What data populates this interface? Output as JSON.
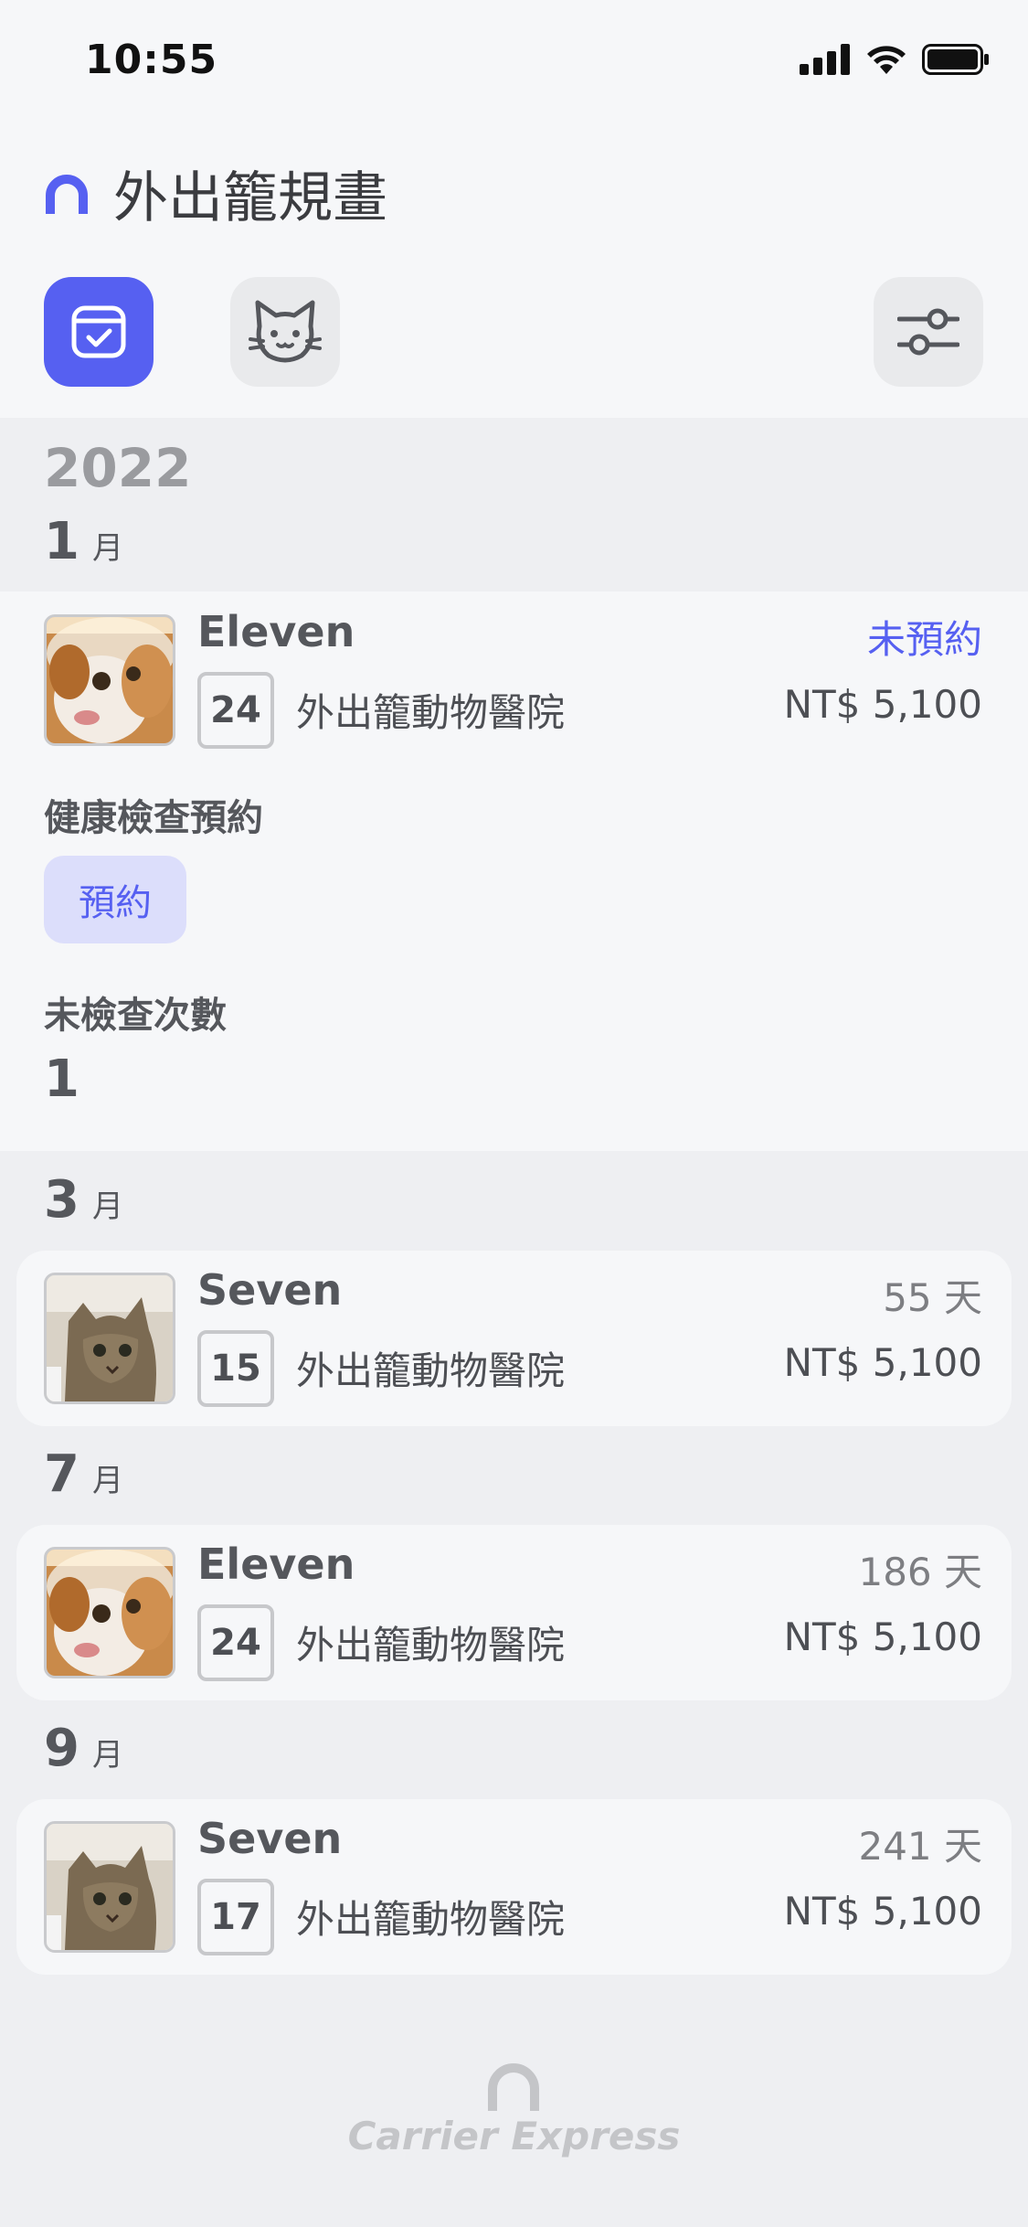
{
  "status_bar": {
    "time": "10:55"
  },
  "header": {
    "title": "外出籠規畫"
  },
  "toolbar": {
    "calendar_icon": "calendar-check-icon",
    "cat_icon": "cat-icon",
    "filter_icon": "sliders-icon"
  },
  "year": "2022",
  "month_unit": "月",
  "months": [
    {
      "num": "1"
    },
    {
      "num": "3"
    },
    {
      "num": "7"
    },
    {
      "num": "9"
    }
  ],
  "entries": [
    {
      "name": "Eleven",
      "day": "24",
      "clinic": "外出籠動物醫院",
      "status": "未預約",
      "price": "NT$ 5,100"
    },
    {
      "name": "Seven",
      "day": "15",
      "clinic": "外出籠動物醫院",
      "status": "55 天",
      "price": "NT$ 5,100"
    },
    {
      "name": "Eleven",
      "day": "24",
      "clinic": "外出籠動物醫院",
      "status": "186 天",
      "price": "NT$ 5,100"
    },
    {
      "name": "Seven",
      "day": "17",
      "clinic": "外出籠動物醫院",
      "status": "241 天",
      "price": "NT$ 5,100"
    }
  ],
  "detail": {
    "health_check_label": "健康檢查預約",
    "reserve_button": "預約",
    "unchecked_label": "未檢查次數",
    "unchecked_count": "1"
  },
  "footer": {
    "brand": "Carrier Express"
  },
  "colors": {
    "accent": "#5660f1",
    "accent_light": "#dcdefb"
  }
}
